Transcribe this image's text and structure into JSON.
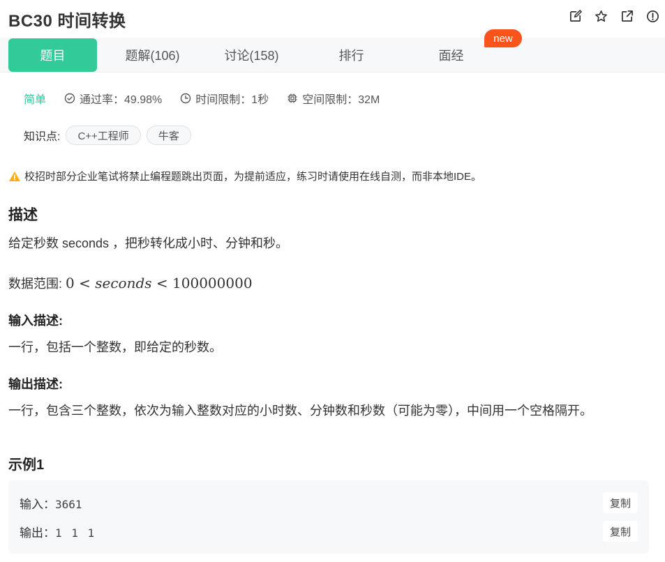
{
  "header": {
    "title": "BC30  时间转换",
    "icons": [
      "edit-icon",
      "star-icon",
      "share-icon",
      "info-icon"
    ]
  },
  "tabs": [
    {
      "label": "题目",
      "active": true
    },
    {
      "label": "题解(106)",
      "active": false
    },
    {
      "label": "讨论(158)",
      "active": false
    },
    {
      "label": "排行",
      "active": false
    },
    {
      "label": "面经",
      "active": false
    }
  ],
  "badge_new": "new",
  "meta": {
    "difficulty": "简单",
    "pass_rate": "通过率：49.98%",
    "time_limit": "时间限制：1秒",
    "space_limit": "空间限制：32M"
  },
  "knowledge": {
    "label": "知识点:",
    "tags": [
      "C++工程师",
      "牛客"
    ]
  },
  "warning": "校招时部分企业笔试将禁止编程题跳出页面，为提前适应，练习时请使用在线自测，而非本地IDE。",
  "description": {
    "heading": "描述",
    "text": "给定秒数 seconds ，把秒转化成小时、分钟和秒。",
    "range_label": "数据范围: ",
    "range_lower": "0",
    "range_lt": "<",
    "range_var": "seconds",
    "range_upper": "100000000"
  },
  "input": {
    "heading": "输入描述:",
    "text": "一行，包括一个整数，即给定的秒数。"
  },
  "output": {
    "heading": "输出描述:",
    "text": "一行，包含三个整数，依次为输入整数对应的小时数、分钟数和秒数（可能为零），中间用一个空格隔开。"
  },
  "example": {
    "heading": "示例1",
    "input_label": "输入：",
    "input_value": "3661",
    "output_label": "输出：",
    "output_value": "1 1 1",
    "copy_label": "复制"
  },
  "colors": {
    "accent": "#32ca99",
    "badge": "#fa541c",
    "warning": "#faad14"
  }
}
